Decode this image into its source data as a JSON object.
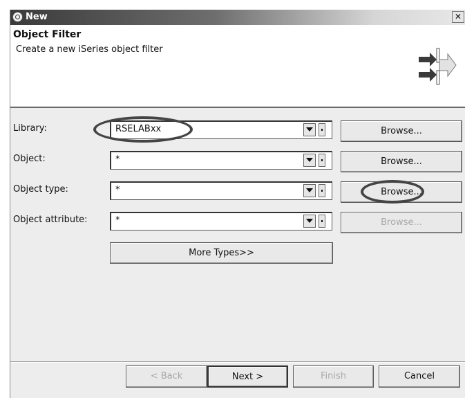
{
  "window": {
    "title": "New",
    "close_glyph": "✕"
  },
  "header": {
    "title": "Object Filter",
    "description": "Create a new iSeries object filter",
    "graphic_icon": "filter-arrows-icon"
  },
  "form": {
    "library": {
      "label": "Library:",
      "value": "RSELABxx",
      "browse": "Browse..."
    },
    "object": {
      "label": "Object:",
      "value": "*",
      "browse": "Browse..."
    },
    "object_type": {
      "label": "Object type:",
      "value": "*",
      "browse": "Browse..."
    },
    "object_attribute": {
      "label": "Object attribute:",
      "value": "*",
      "browse": "Browse..."
    },
    "more_types": "More Types>>"
  },
  "buttons": {
    "back": "< Back",
    "next": "Next >",
    "finish": "Finish",
    "cancel": "Cancel"
  },
  "colors": {
    "title_gradient_start": "#3a3a3a",
    "dialog_bg": "#ededed",
    "header_bg": "#ffffff",
    "disabled_text": "#a8a8a8"
  }
}
